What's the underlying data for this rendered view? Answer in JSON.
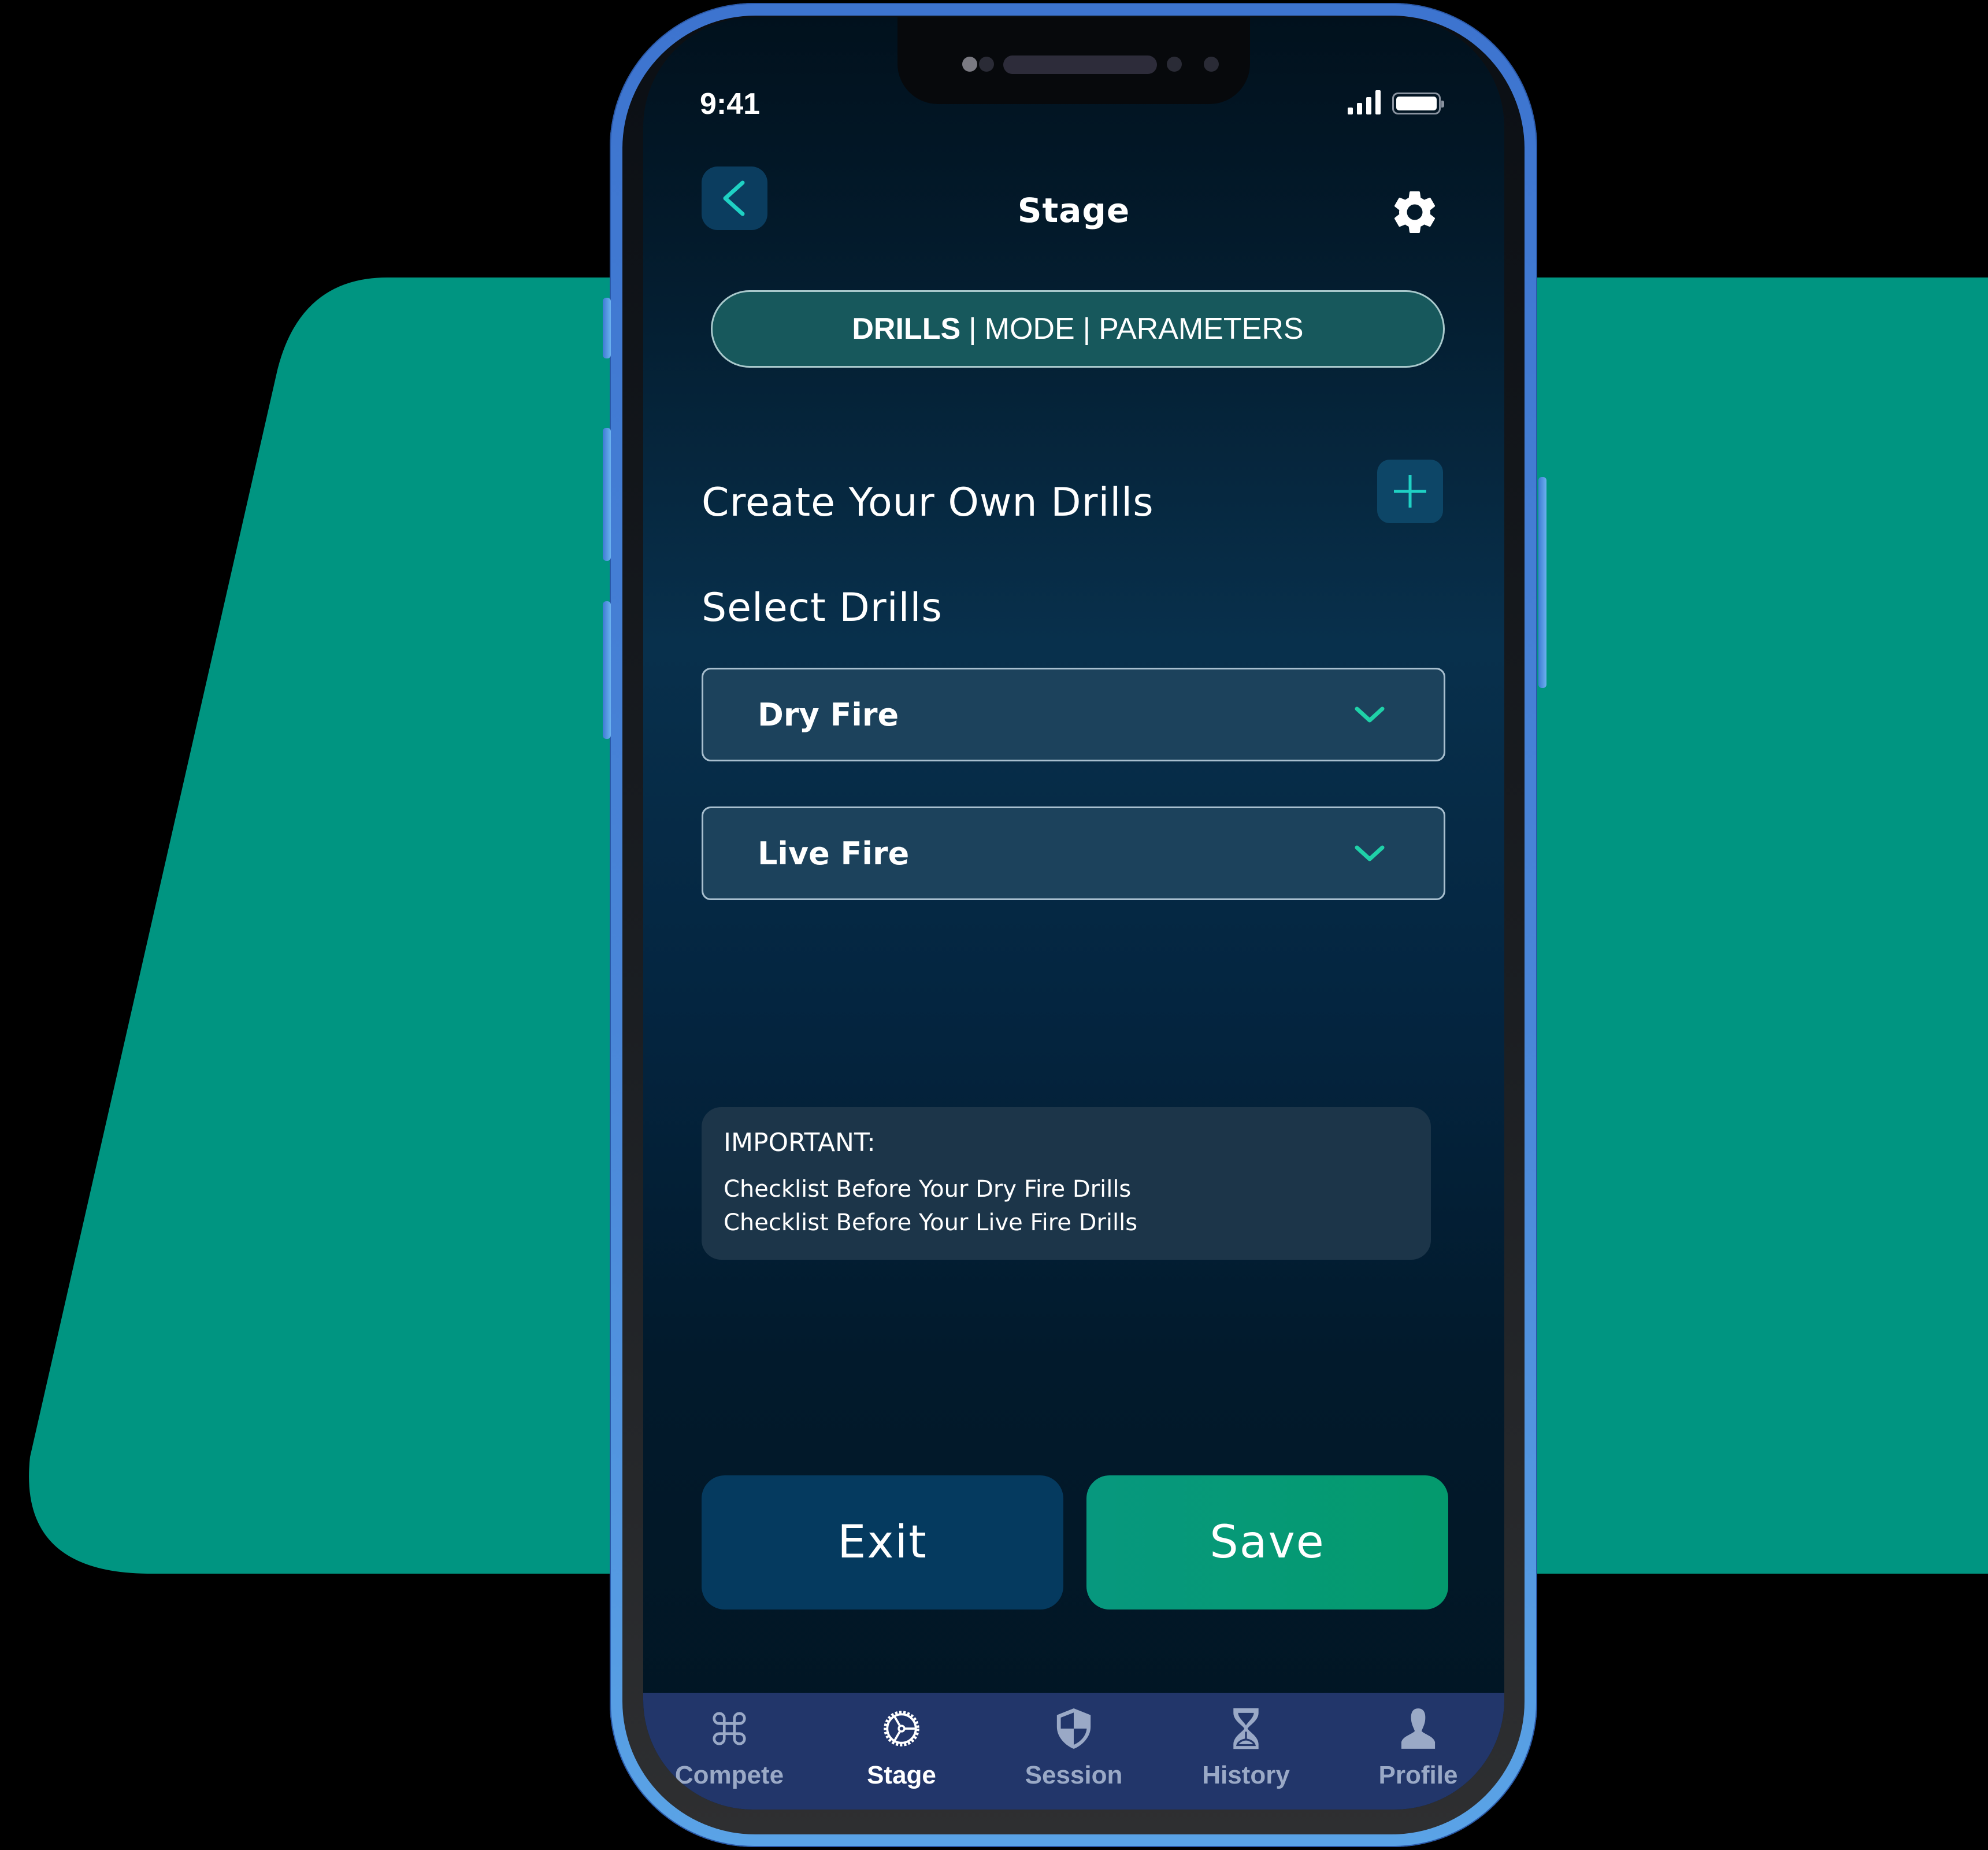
{
  "status_bar": {
    "time": "9:41"
  },
  "header": {
    "title": "Stage",
    "back_icon": "chevron-left-icon",
    "settings_icon": "gear-icon"
  },
  "segmented": {
    "items": [
      {
        "label": "DRILLS",
        "active": true
      },
      {
        "label": "MODE",
        "active": false
      },
      {
        "label": "PARAMETERS",
        "active": false
      }
    ],
    "separator": "|"
  },
  "create": {
    "title": "Create Your Own Drills",
    "add_icon": "plus-icon"
  },
  "select": {
    "title": "Select Drills",
    "dropdowns": [
      {
        "label": "Dry Fire",
        "icon": "chevron-down-icon"
      },
      {
        "label": "Live Fire",
        "icon": "chevron-down-icon"
      }
    ]
  },
  "notice": {
    "heading": "IMPORTANT:",
    "lines": [
      "Checklist Before Your Dry Fire Drills",
      "Checklist Before Your Live Fire Drills"
    ]
  },
  "actions": {
    "exit_label": "Exit",
    "save_label": "Save"
  },
  "tabbar": {
    "items": [
      {
        "label": "Compete",
        "icon": "command-icon",
        "active": false
      },
      {
        "label": "Stage",
        "icon": "gear-wheel-icon",
        "active": true
      },
      {
        "label": "Session",
        "icon": "shield-icon",
        "active": false
      },
      {
        "label": "History",
        "icon": "hourglass-icon",
        "active": false
      },
      {
        "label": "Profile",
        "icon": "user-icon",
        "active": false
      }
    ]
  },
  "colors": {
    "accent": "#1fd1b7",
    "backdrop": "#009581",
    "save": "#049a78",
    "exit": "#053a5f",
    "tabbar": "#22366a"
  }
}
